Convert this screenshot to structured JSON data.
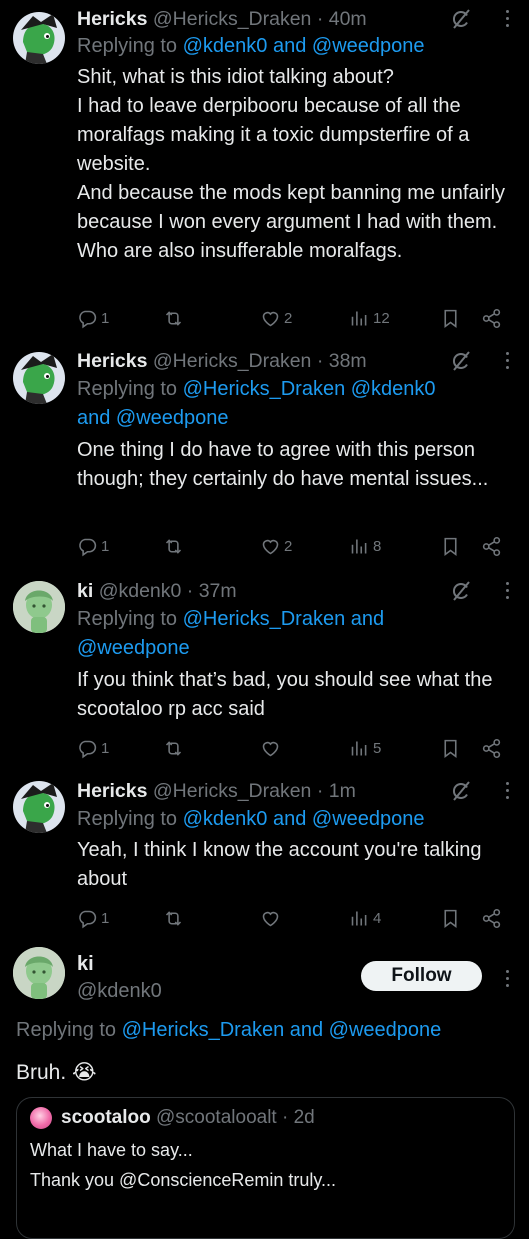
{
  "tweets": [
    {
      "name": "Hericks",
      "handle": "@Hericks_Draken",
      "time": "· 40m",
      "replying": "Replying to",
      "mentions": "@kdenk0 and @weedpone",
      "text": "Shit, what is this idiot talking about?\nI had to leave derpibooru because of all the moralfags making it a toxic dumpsterfire of a website.\nAnd because the mods kept banning me unfairly because I won every argument I had with them. Who are also insufferable moralfags.",
      "replies": "1",
      "retweets": "",
      "likes": "2",
      "views": "12"
    },
    {
      "name": "Hericks",
      "handle": "@Hericks_Draken",
      "time": "· 38m",
      "replying": "Replying to",
      "mentions": "@Hericks_Draken @kdenk0\nand @weedpone",
      "text": "One thing I do have to agree with this person though; they certainly do have mental issues...",
      "replies": "1",
      "retweets": "",
      "likes": "2",
      "views": "8"
    },
    {
      "name": "ki",
      "handle": "@kdenk0",
      "time": "· 37m",
      "replying": "Replying to",
      "mentions": "@Hericks_Draken and\n@weedpone",
      "text": "If you think that’s bad, you should see what the scootaloo rp acc said",
      "replies": "1",
      "retweets": "",
      "likes": "",
      "views": "5"
    },
    {
      "name": "Hericks",
      "handle": "@Hericks_Draken",
      "time": "· 1m",
      "replying": "Replying to",
      "mentions": "@kdenk0 and @weedpone",
      "text": "Yeah, I think I know the account you're talking about",
      "replies": "1",
      "retweets": "",
      "likes": "",
      "views": "4"
    }
  ],
  "main": {
    "name": "ki",
    "handle": "@kdenk0",
    "follow": "Follow",
    "replying": "Replying to",
    "mentions": "@Hericks_Draken and @weedpone",
    "text": "Bruh.",
    "emoji": "😭"
  },
  "quote": {
    "name": "scootaloo",
    "handle": "@scootalooalt",
    "time": "· 2d",
    "line1": "What I have to say...",
    "line2": "Thank you @ConscienceRemin truly..."
  },
  "colors": {
    "bg": "#000000",
    "text": "#e7e9ea",
    "muted": "#71767b",
    "link": "#1d9bf0"
  }
}
